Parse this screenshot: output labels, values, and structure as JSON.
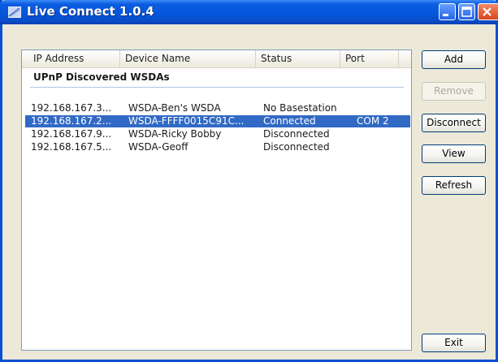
{
  "window": {
    "title": "Live Connect 1.0.4"
  },
  "listview": {
    "columns": [
      "IP Address",
      "Device Name",
      "Status",
      "Port"
    ],
    "group_label": "UPnP Discovered WSDAs",
    "rows": [
      {
        "ip": "192.168.167.3...",
        "name": "WSDA-Ben's WSDA",
        "status": "No Basestation",
        "port": ""
      },
      {
        "ip": "192.168.167.2...",
        "name": "WSDA-FFFF0015C91C...",
        "status": "Connected",
        "port": "COM 2",
        "selected": true
      },
      {
        "ip": "192.168.167.9...",
        "name": "WSDA-Ricky Bobby",
        "status": "Disconnected",
        "port": ""
      },
      {
        "ip": "192.168.167.5...",
        "name": "WSDA-Geoff",
        "status": "Disconnected",
        "port": ""
      }
    ]
  },
  "buttons": {
    "add": "Add",
    "remove": "Remove",
    "disconnect": "Disconnect",
    "view": "View",
    "refresh": "Refresh",
    "exit": "Exit"
  },
  "colors": {
    "titlebar": "#0655db",
    "selection": "#316ac5",
    "window_bg": "#ece9d8"
  },
  "icons": {
    "app": "live-connect-app-icon",
    "minimize": "minimize-icon",
    "maximize": "maximize-icon",
    "close": "close-icon"
  }
}
